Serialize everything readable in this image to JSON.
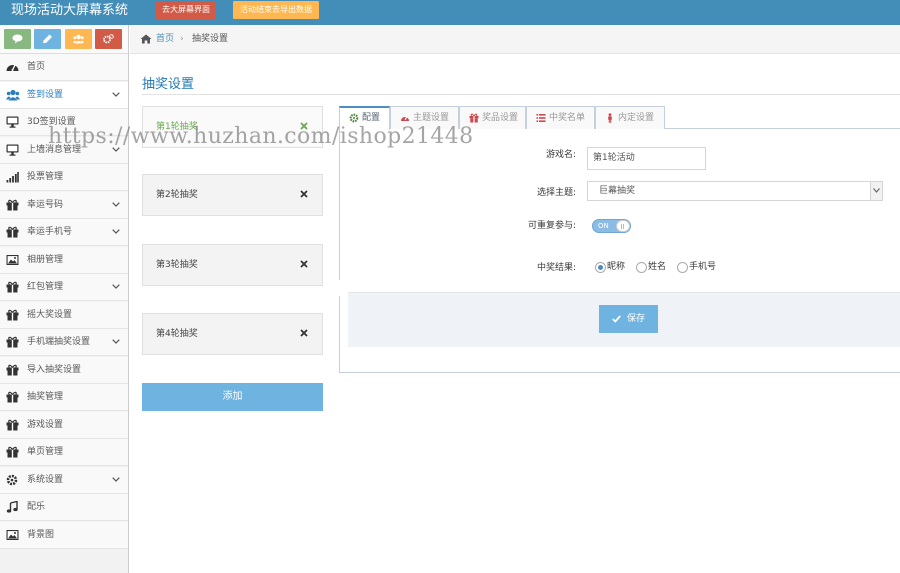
{
  "header": {
    "brand": "现场活动大屏幕系统",
    "btn_screen": "去大屏幕界面",
    "btn_export": "活动结束去导出数据"
  },
  "colors": {
    "header_bg": "#438eb9",
    "accent": "#6fb3e0",
    "active_text": "#2b7dbc",
    "red": "#d15b47",
    "orange": "#ffb752"
  },
  "shortcuts": [
    {
      "icon": "comment-icon",
      "color": "#87b87f"
    },
    {
      "icon": "pencil-icon",
      "color": "#6fb3e0"
    },
    {
      "icon": "users-icon",
      "color": "#ffb752"
    },
    {
      "icon": "cogs-icon",
      "color": "#d15b47"
    }
  ],
  "sidebar": {
    "items": [
      {
        "label": "首页",
        "icon": "dashboard-icon"
      },
      {
        "label": "签到设置",
        "icon": "users-icon",
        "active": true,
        "expandable": true
      },
      {
        "label": "3D签到设置",
        "icon": "desktop-icon"
      },
      {
        "label": "上墙消息管理",
        "icon": "desktop-icon",
        "expandable": true
      },
      {
        "label": "投票管理",
        "icon": "signal-icon"
      },
      {
        "label": "幸运号码",
        "icon": "gift-icon",
        "expandable": true
      },
      {
        "label": "幸运手机号",
        "icon": "gift-icon",
        "expandable": true
      },
      {
        "label": "相册管理",
        "icon": "picture-icon"
      },
      {
        "label": "红包管理",
        "icon": "gift-icon",
        "expandable": true
      },
      {
        "label": "摇大奖设置",
        "icon": "gift-icon"
      },
      {
        "label": "手机端抽奖设置",
        "icon": "gift-icon",
        "expandable": true
      },
      {
        "label": "导入抽奖设置",
        "icon": "gift-icon"
      },
      {
        "label": "抽奖管理",
        "icon": "gift-icon"
      },
      {
        "label": "游戏设置",
        "icon": "gift-icon"
      },
      {
        "label": "单页管理",
        "icon": "gift-icon"
      },
      {
        "label": "系统设置",
        "icon": "cog-icon",
        "expandable": true
      },
      {
        "label": "配乐",
        "icon": "music-icon"
      },
      {
        "label": "背景图",
        "icon": "picture-icon"
      }
    ]
  },
  "breadcrumb": {
    "home": "首页",
    "separator": "›",
    "current": "抽奖设置"
  },
  "page_title": "抽奖设置",
  "rounds": [
    {
      "label": "第1轮抽奖",
      "active": true
    },
    {
      "label": "第2轮抽奖"
    },
    {
      "label": "第3轮抽奖"
    },
    {
      "label": "第4轮抽奖"
    }
  ],
  "add_label": "添加",
  "tabs": [
    {
      "label": "配置",
      "icon": "cog-icon",
      "active": true
    },
    {
      "label": "主题设置",
      "icon": "dashboard-icon"
    },
    {
      "label": "奖品设置",
      "icon": "gift-icon"
    },
    {
      "label": "中奖名单",
      "icon": "list-icon"
    },
    {
      "label": "内定设置",
      "icon": "user-icon"
    }
  ],
  "form": {
    "game_name_label": "游戏名:",
    "game_name_value": "第1轮活动",
    "theme_label": "选择主题:",
    "theme_value": "巨幕抽奖",
    "repeat_label": "可重复参与:",
    "repeat_toggle": "ON",
    "result_label": "中奖结果:",
    "result_options": [
      "昵称",
      "姓名",
      "手机号"
    ],
    "result_selected": 0,
    "save_label": "保存"
  },
  "watermark": "https://www.huzhan.com/ishop21448"
}
